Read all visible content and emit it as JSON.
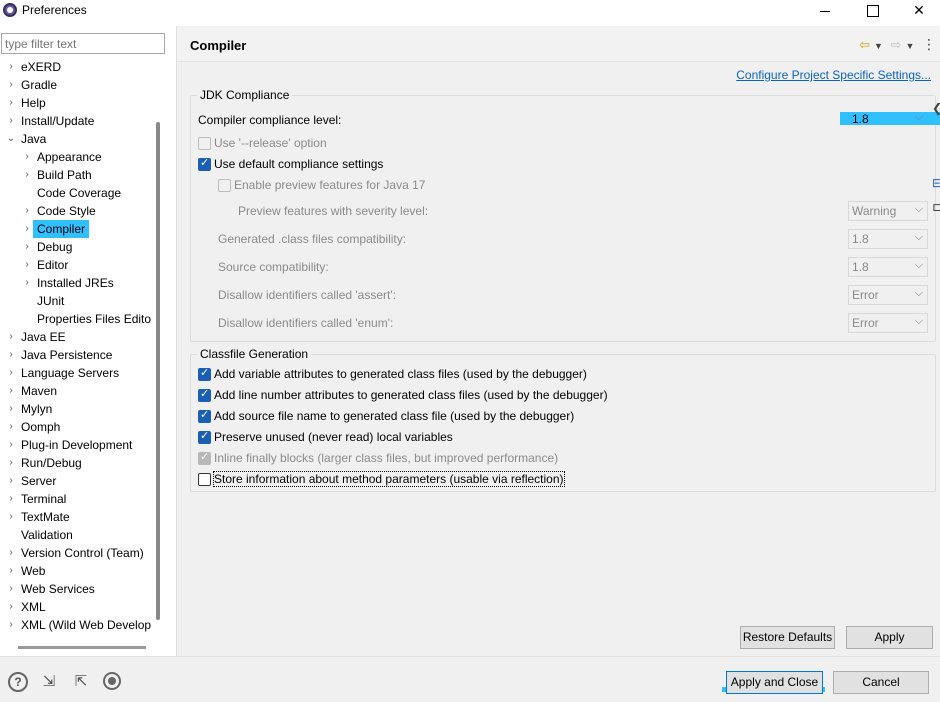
{
  "window": {
    "title": "Preferences"
  },
  "filter": {
    "placeholder": "type filter text"
  },
  "tree": [
    {
      "label": "eXERD",
      "level": 0,
      "chevron": "right"
    },
    {
      "label": "Gradle",
      "level": 0,
      "chevron": "right"
    },
    {
      "label": "Help",
      "level": 0,
      "chevron": "right"
    },
    {
      "label": "Install/Update",
      "level": 0,
      "chevron": "right"
    },
    {
      "label": "Java",
      "level": 0,
      "chevron": "down"
    },
    {
      "label": "Appearance",
      "level": 1,
      "chevron": "right"
    },
    {
      "label": "Build Path",
      "level": 1,
      "chevron": "right"
    },
    {
      "label": "Code Coverage",
      "level": 1,
      "chevron": ""
    },
    {
      "label": "Code Style",
      "level": 1,
      "chevron": "right"
    },
    {
      "label": "Compiler",
      "level": 1,
      "chevron": "right",
      "selected": true
    },
    {
      "label": "Debug",
      "level": 1,
      "chevron": "right"
    },
    {
      "label": "Editor",
      "level": 1,
      "chevron": "right"
    },
    {
      "label": "Installed JREs",
      "level": 1,
      "chevron": "right"
    },
    {
      "label": "JUnit",
      "level": 1,
      "chevron": ""
    },
    {
      "label": "Properties Files Edito",
      "level": 1,
      "chevron": ""
    },
    {
      "label": "Java EE",
      "level": 0,
      "chevron": "right"
    },
    {
      "label": "Java Persistence",
      "level": 0,
      "chevron": "right"
    },
    {
      "label": "Language Servers",
      "level": 0,
      "chevron": "right"
    },
    {
      "label": "Maven",
      "level": 0,
      "chevron": "right"
    },
    {
      "label": "Mylyn",
      "level": 0,
      "chevron": "right"
    },
    {
      "label": "Oomph",
      "level": 0,
      "chevron": "right"
    },
    {
      "label": "Plug-in Development",
      "level": 0,
      "chevron": "right"
    },
    {
      "label": "Run/Debug",
      "level": 0,
      "chevron": "right"
    },
    {
      "label": "Server",
      "level": 0,
      "chevron": "right"
    },
    {
      "label": "Terminal",
      "level": 0,
      "chevron": "right"
    },
    {
      "label": "TextMate",
      "level": 0,
      "chevron": "right"
    },
    {
      "label": "Validation",
      "level": 0,
      "chevron": ""
    },
    {
      "label": "Version Control (Team)",
      "level": 0,
      "chevron": "right"
    },
    {
      "label": "Web",
      "level": 0,
      "chevron": "right"
    },
    {
      "label": "Web Services",
      "level": 0,
      "chevron": "right"
    },
    {
      "label": "XML",
      "level": 0,
      "chevron": "right"
    },
    {
      "label": "XML (Wild Web Develop",
      "level": 0,
      "chevron": "right"
    }
  ],
  "page": {
    "title": "Compiler",
    "config_link": "Configure Project Specific Settings..."
  },
  "jdk": {
    "group_title": "JDK Compliance",
    "compliance_label": "Compiler compliance level:",
    "compliance_value": "1.8",
    "release_option": "Use '--release' option",
    "default_settings": "Use default compliance settings",
    "preview_features": "Enable preview features for Java 17",
    "preview_severity_label": "Preview features with severity level:",
    "preview_severity_value": "Warning",
    "generated_label": "Generated .class files compatibility:",
    "generated_value": "1.8",
    "source_label": "Source compatibility:",
    "source_value": "1.8",
    "assert_label": "Disallow identifiers called 'assert':",
    "assert_value": "Error",
    "enum_label": "Disallow identifiers called 'enum':",
    "enum_value": "Error"
  },
  "classfile": {
    "group_title": "Classfile Generation",
    "options": [
      {
        "label": "Add variable attributes to generated class files (used by the debugger)",
        "checked": true
      },
      {
        "label": "Add line number attributes to generated class files (used by the debugger)",
        "checked": true
      },
      {
        "label": "Add source file name to generated class file (used by the debugger)",
        "checked": true
      },
      {
        "label": "Preserve unused (never read) local variables",
        "checked": true
      },
      {
        "label": "Inline finally blocks (larger class files, but improved performance)",
        "checked": true,
        "disabled": true
      },
      {
        "label": "Store information about method parameters (usable via reflection)",
        "checked": false
      }
    ]
  },
  "buttons": {
    "restore_defaults": "Restore Defaults",
    "apply": "Apply",
    "apply_and_close": "Apply and Close",
    "cancel": "Cancel"
  },
  "colors": {
    "highlight": "#30c0ff",
    "link": "#0b62c4",
    "checkbox": "#1a5fb4"
  }
}
